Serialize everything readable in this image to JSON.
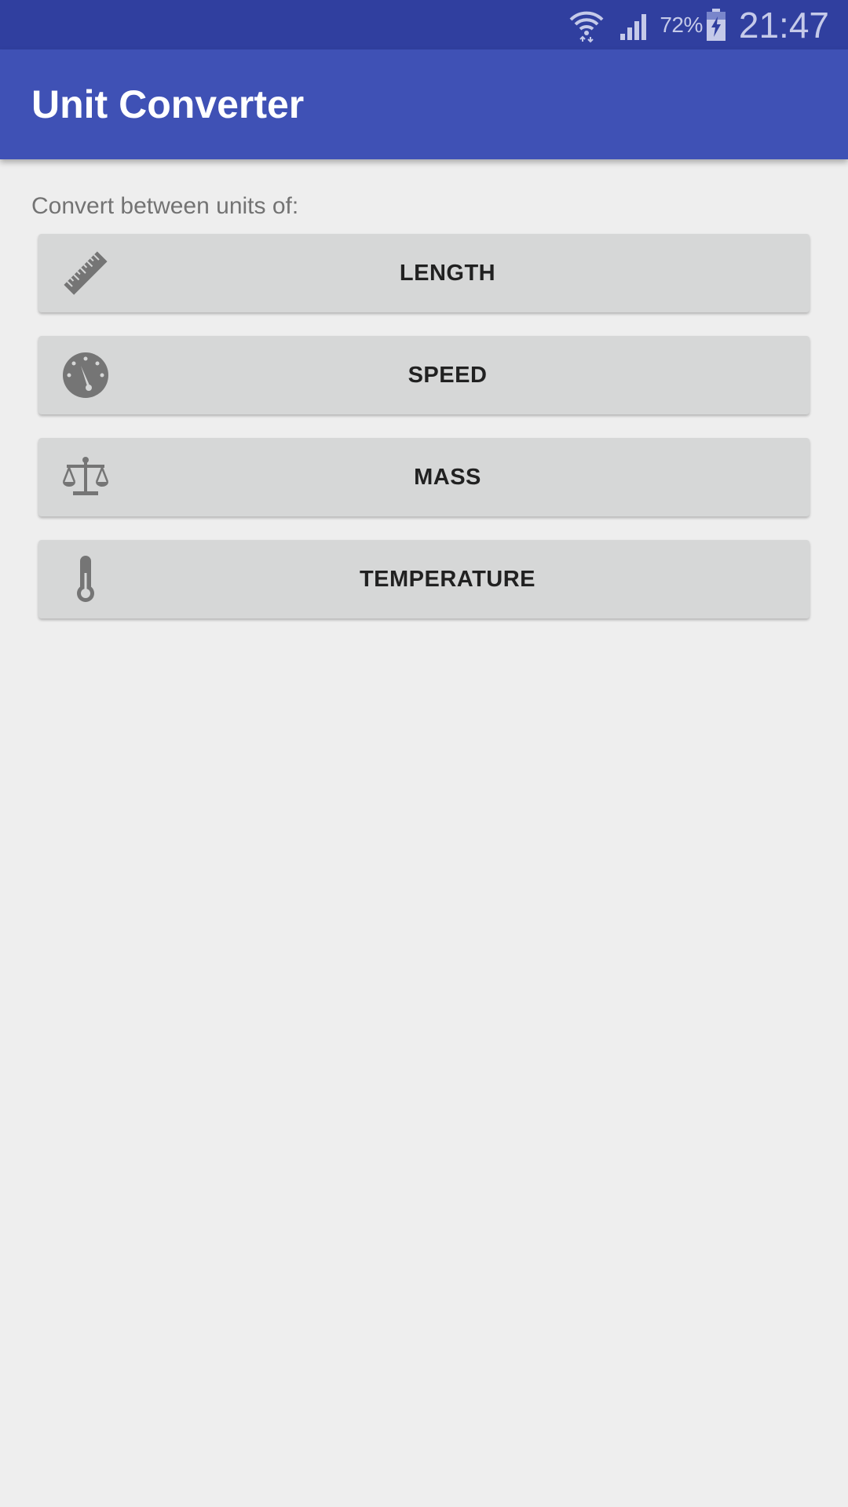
{
  "status_bar": {
    "battery_percent": "72%",
    "time": "21:47",
    "icons": [
      "wifi-icon",
      "signal-icon",
      "battery-charging-icon"
    ]
  },
  "app_bar": {
    "title": "Unit Converter"
  },
  "main": {
    "intro": "Convert between units of:",
    "buttons": [
      {
        "label": "LENGTH",
        "icon": "ruler-icon"
      },
      {
        "label": "SPEED",
        "icon": "speedometer-icon"
      },
      {
        "label": "MASS",
        "icon": "scale-icon"
      },
      {
        "label": "TEMPERATURE",
        "icon": "thermometer-icon"
      }
    ]
  },
  "colors": {
    "status_bar": "#303f9f",
    "primary": "#3f51b5",
    "background": "#eeeeee",
    "button": "#d6d7d7",
    "icon": "#757575"
  }
}
